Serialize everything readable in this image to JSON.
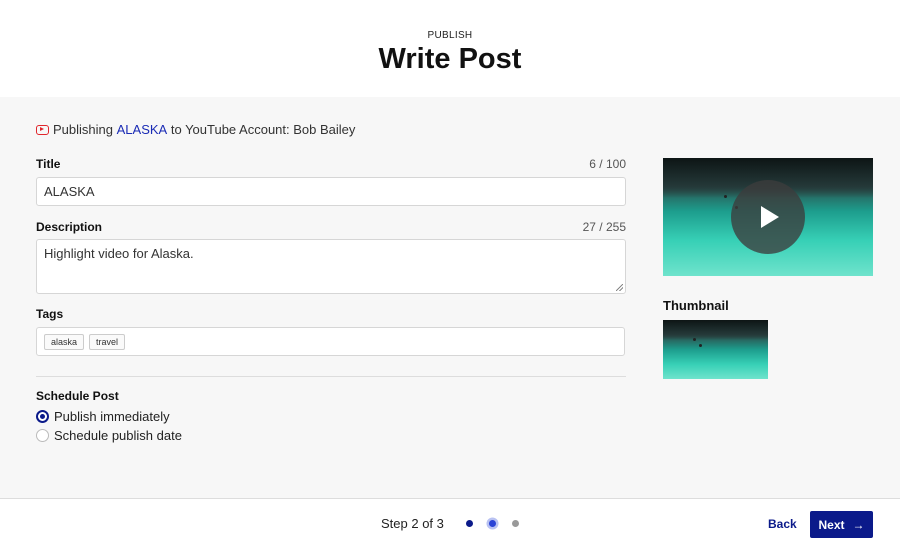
{
  "header": {
    "eyebrow": "PUBLISH",
    "title": "Write Post"
  },
  "publishing": {
    "prefix": "Publishing",
    "video_name": "ALASKA",
    "suffix": "to YouTube Account: Bob Bailey",
    "icon": "youtube-icon"
  },
  "form": {
    "title": {
      "label": "Title",
      "counter": "6 / 100",
      "value": "ALASKA"
    },
    "description": {
      "label": "Description",
      "counter": "27 / 255",
      "value": "Highlight video for Alaska."
    },
    "tags": {
      "label": "Tags",
      "items": [
        "alaska",
        "travel"
      ]
    },
    "schedule": {
      "label": "Schedule Post",
      "options": [
        {
          "label": "Publish immediately",
          "selected": true
        },
        {
          "label": "Schedule publish date",
          "selected": false
        }
      ]
    }
  },
  "media": {
    "thumbnail_label": "Thumbnail",
    "play_icon": "play-icon"
  },
  "footer": {
    "step_text": "Step 2 of 3",
    "back_label": "Back",
    "next_label": "Next",
    "next_icon": "arrow-right-icon"
  },
  "colors": {
    "accent": "#0b1a8a",
    "link": "#1a2bb5",
    "youtube": "#e0262c"
  }
}
